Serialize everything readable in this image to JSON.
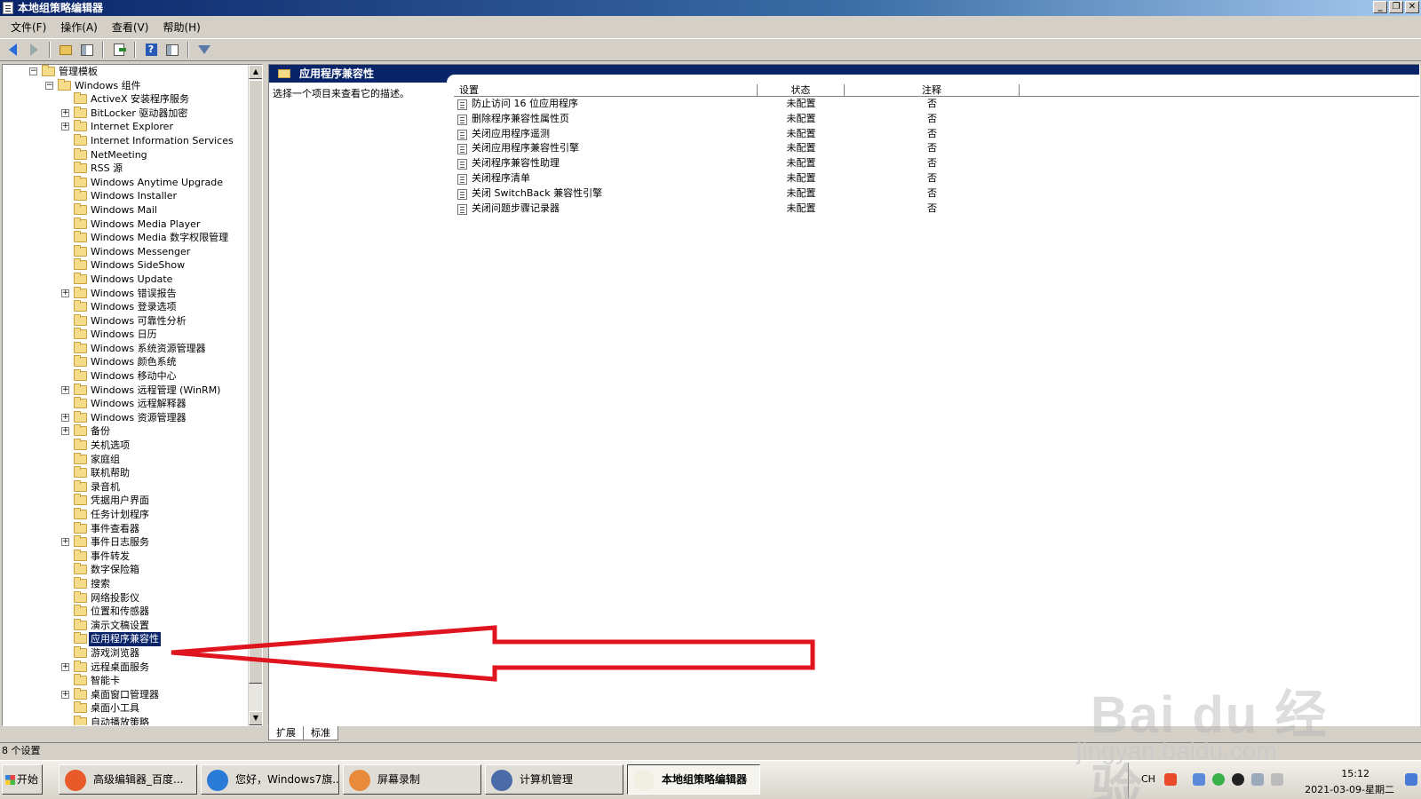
{
  "window": {
    "title": "本地组策略编辑器",
    "buttons": [
      "_",
      "❐",
      "✕"
    ]
  },
  "menu": [
    "文件(F)",
    "操作(A)",
    "查看(V)",
    "帮助(H)"
  ],
  "toolbar": {
    "icons": [
      "back-arrow-icon",
      "forward-arrow-icon",
      "up-folder-icon",
      "show-hide-tree-icon",
      "export-list-icon",
      "help-icon",
      "view-icon",
      "filter-icon"
    ]
  },
  "tree": {
    "nodes": [
      {
        "label": "管理模板",
        "level": 0,
        "expander": "−"
      },
      {
        "label": "Windows 组件",
        "level": 1,
        "expander": "−"
      },
      {
        "label": "ActiveX 安装程序服务",
        "level": 2,
        "expander": ""
      },
      {
        "label": "BitLocker 驱动器加密",
        "level": 2,
        "expander": "+"
      },
      {
        "label": "Internet Explorer",
        "level": 2,
        "expander": "+"
      },
      {
        "label": "Internet Information Services",
        "level": 2,
        "expander": ""
      },
      {
        "label": "NetMeeting",
        "level": 2,
        "expander": ""
      },
      {
        "label": "RSS 源",
        "level": 2,
        "expander": ""
      },
      {
        "label": "Windows Anytime Upgrade",
        "level": 2,
        "expander": ""
      },
      {
        "label": "Windows Installer",
        "level": 2,
        "expander": ""
      },
      {
        "label": "Windows Mail",
        "level": 2,
        "expander": ""
      },
      {
        "label": "Windows Media Player",
        "level": 2,
        "expander": ""
      },
      {
        "label": "Windows Media 数字权限管理",
        "level": 2,
        "expander": ""
      },
      {
        "label": "Windows Messenger",
        "level": 2,
        "expander": ""
      },
      {
        "label": "Windows SideShow",
        "level": 2,
        "expander": ""
      },
      {
        "label": "Windows Update",
        "level": 2,
        "expander": ""
      },
      {
        "label": "Windows 错误报告",
        "level": 2,
        "expander": "+"
      },
      {
        "label": "Windows 登录选项",
        "level": 2,
        "expander": ""
      },
      {
        "label": "Windows 可靠性分析",
        "level": 2,
        "expander": ""
      },
      {
        "label": "Windows 日历",
        "level": 2,
        "expander": ""
      },
      {
        "label": "Windows 系统资源管理器",
        "level": 2,
        "expander": ""
      },
      {
        "label": "Windows 颜色系统",
        "level": 2,
        "expander": ""
      },
      {
        "label": "Windows 移动中心",
        "level": 2,
        "expander": ""
      },
      {
        "label": "Windows 远程管理 (WinRM)",
        "level": 2,
        "expander": "+"
      },
      {
        "label": "Windows 远程解释器",
        "level": 2,
        "expander": ""
      },
      {
        "label": "Windows 资源管理器",
        "level": 2,
        "expander": "+"
      },
      {
        "label": "备份",
        "level": 2,
        "expander": "+"
      },
      {
        "label": "关机选项",
        "level": 2,
        "expander": ""
      },
      {
        "label": "家庭组",
        "level": 2,
        "expander": ""
      },
      {
        "label": "联机帮助",
        "level": 2,
        "expander": ""
      },
      {
        "label": "录音机",
        "level": 2,
        "expander": ""
      },
      {
        "label": "凭据用户界面",
        "level": 2,
        "expander": ""
      },
      {
        "label": "任务计划程序",
        "level": 2,
        "expander": ""
      },
      {
        "label": "事件查看器",
        "level": 2,
        "expander": ""
      },
      {
        "label": "事件日志服务",
        "level": 2,
        "expander": "+"
      },
      {
        "label": "事件转发",
        "level": 2,
        "expander": ""
      },
      {
        "label": "数字保险箱",
        "level": 2,
        "expander": ""
      },
      {
        "label": "搜索",
        "level": 2,
        "expander": ""
      },
      {
        "label": "网络投影仪",
        "level": 2,
        "expander": ""
      },
      {
        "label": "位置和传感器",
        "level": 2,
        "expander": ""
      },
      {
        "label": "演示文稿设置",
        "level": 2,
        "expander": ""
      },
      {
        "label": "应用程序兼容性",
        "level": 2,
        "expander": "",
        "selected": true
      },
      {
        "label": "游戏浏览器",
        "level": 2,
        "expander": ""
      },
      {
        "label": "远程桌面服务",
        "level": 2,
        "expander": "+"
      },
      {
        "label": "智能卡",
        "level": 2,
        "expander": ""
      },
      {
        "label": "桌面窗口管理器",
        "level": 2,
        "expander": "+"
      },
      {
        "label": "桌面小工具",
        "level": 2,
        "expander": ""
      },
      {
        "label": "自动播放策略",
        "level": 2,
        "expander": ""
      }
    ]
  },
  "right": {
    "title": "应用程序兼容性",
    "description": "选择一个项目来查看它的描述。",
    "columns": {
      "setting": "设置",
      "state": "状态",
      "comment": "注释"
    },
    "rows": [
      {
        "setting": "防止访问 16 位应用程序",
        "state": "未配置",
        "comment": "否"
      },
      {
        "setting": "删除程序兼容性属性页",
        "state": "未配置",
        "comment": "否"
      },
      {
        "setting": "关闭应用程序遥测",
        "state": "未配置",
        "comment": "否"
      },
      {
        "setting": "关闭应用程序兼容性引擎",
        "state": "未配置",
        "comment": "否"
      },
      {
        "setting": "关闭程序兼容性助理",
        "state": "未配置",
        "comment": "否"
      },
      {
        "setting": "关闭程序清单",
        "state": "未配置",
        "comment": "否"
      },
      {
        "setting": "关闭 SwitchBack 兼容性引擎",
        "state": "未配置",
        "comment": "否"
      },
      {
        "setting": "关闭问题步骤记录器",
        "state": "未配置",
        "comment": "否"
      }
    ],
    "bottom_tabs": [
      "扩展",
      "标准"
    ]
  },
  "status": "8 个设置",
  "taskbar": {
    "start": "开始",
    "items": [
      {
        "label": "高级编辑器_百度...",
        "color": "#e85a2a",
        "active": false
      },
      {
        "label": "您好，Windows7旗...",
        "color": "#2a7ad8",
        "active": false
      },
      {
        "label": "屏幕录制",
        "color": "#e88a3a",
        "active": false
      },
      {
        "label": "计算机管理",
        "color": "#4a6aa8",
        "active": false
      },
      {
        "label": "本地组策略编辑器",
        "color": "#f0f0e0",
        "active": true
      }
    ],
    "tray": {
      "lang": "CH",
      "time": "15:12",
      "date": "2021-03-09-星期二"
    }
  },
  "watermark": {
    "brand": "Bai du 经验",
    "url": "jingyan.baidu.com"
  },
  "annotation": {
    "color": "#e0141e"
  }
}
